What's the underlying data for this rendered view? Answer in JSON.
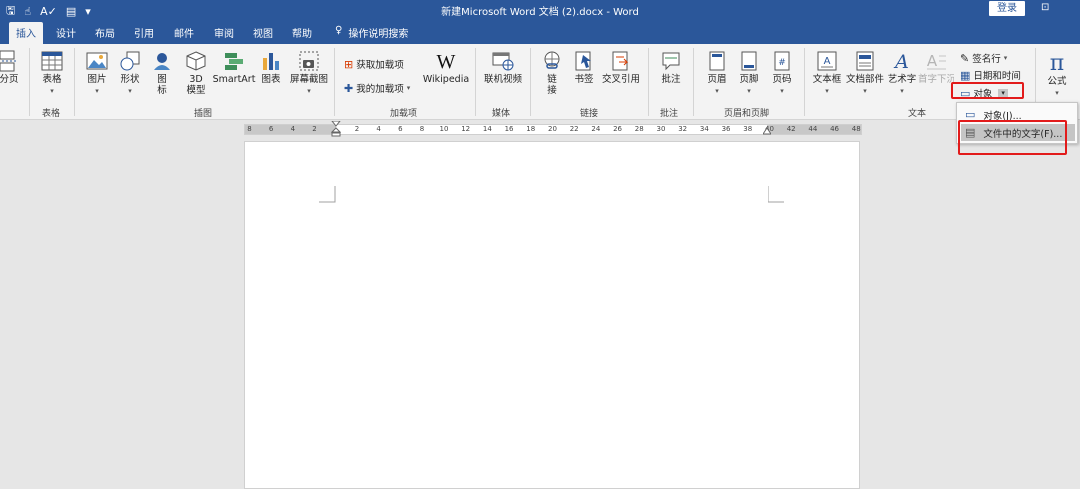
{
  "window": {
    "title": "新建Microsoft Word 文档 (2).docx  -  Word",
    "login_label": "登录"
  },
  "tabs": [
    "插入",
    "设计",
    "布局",
    "引用",
    "邮件",
    "审阅",
    "视图",
    "帮助"
  ],
  "search_hint": "操作说明搜索",
  "ribbon": {
    "page_break": "分页",
    "table": "表格",
    "pictures": "图片",
    "shapes": "形状",
    "icons": "图\n标",
    "models3d": "3D\n模型",
    "smartart": "SmartArt",
    "chart": "图表",
    "screenshot": "屏幕截图",
    "get_addins": "获取加载项",
    "my_addins": "我的加载项",
    "wikipedia": "Wikipedia",
    "online_video": "联机视频",
    "link": "链\n接",
    "bookmark": "书签",
    "cross_ref": "交叉引用",
    "comment": "批注",
    "header": "页眉",
    "footer": "页脚",
    "page_number": "页码",
    "textbox": "文本框",
    "quick_parts": "文档部件",
    "wordart": "艺术字",
    "dropcap": "首字下沉",
    "signature": "签名行",
    "datetime": "日期和时间",
    "object": "对象",
    "equation": "公式"
  },
  "groups": {
    "tables": "表格",
    "illustrations": "插图",
    "addins": "加载项",
    "media": "媒体",
    "links": "链接",
    "comments": "批注",
    "header_footer": "页眉和页脚",
    "text": "文本"
  },
  "ruler": {
    "left_numbers": [
      "8",
      "6",
      "4",
      "2"
    ],
    "right_numbers": [
      "2",
      "4",
      "6",
      "8",
      "10",
      "12",
      "14",
      "16",
      "18",
      "20",
      "22",
      "24",
      "26",
      "28",
      "30",
      "32",
      "34",
      "36",
      "38",
      "40",
      "42",
      "44",
      "46",
      "48"
    ]
  },
  "object_menu": {
    "items": [
      "对象(J)...",
      "文件中的文字(F)..."
    ]
  },
  "colors": {
    "accent": "#2b579a",
    "highlight": "#e21b1b",
    "ribbon_bg": "#f3f3f3"
  }
}
